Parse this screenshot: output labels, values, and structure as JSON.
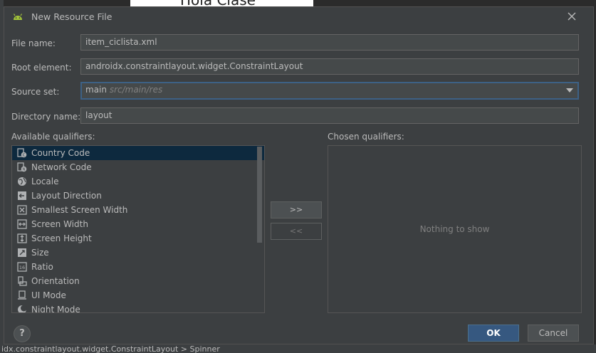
{
  "background": {
    "top_text": "Hola Clase",
    "status_bar_text": "idx.constraintlayout.widget.ConstraintLayout  >  Spinner"
  },
  "dialog": {
    "title": "New Resource File",
    "fields": {
      "file_name": {
        "label": "File name:",
        "value": "item_ciclista.xml"
      },
      "root_element": {
        "label": "Root element:",
        "value": "androidx.constraintlayout.widget.ConstraintLayout"
      },
      "source_set": {
        "label": "Source set:",
        "value": "main",
        "sub_value": "src/main/res"
      },
      "directory_name": {
        "label": "Directory name:",
        "value": "layout"
      }
    },
    "available_qualifiers": {
      "label": "Available qualifiers:",
      "items": [
        {
          "label": "Country Code",
          "icon": "country-code-icon",
          "selected": true
        },
        {
          "label": "Network Code",
          "icon": "network-code-icon"
        },
        {
          "label": "Locale",
          "icon": "globe-icon"
        },
        {
          "label": "Layout Direction",
          "icon": "layout-direction-icon"
        },
        {
          "label": "Smallest Screen Width",
          "icon": "smallest-width-icon"
        },
        {
          "label": "Screen Width",
          "icon": "screen-width-icon"
        },
        {
          "label": "Screen Height",
          "icon": "screen-height-icon"
        },
        {
          "label": "Size",
          "icon": "size-icon"
        },
        {
          "label": "Ratio",
          "icon": "ratio-icon"
        },
        {
          "label": "Orientation",
          "icon": "orientation-icon"
        },
        {
          "label": "UI Mode",
          "icon": "ui-mode-icon"
        },
        {
          "label": "Night Mode",
          "icon": "night-mode-icon"
        }
      ]
    },
    "chosen_qualifiers": {
      "label": "Chosen qualifiers:",
      "empty_text": "Nothing to show"
    },
    "buttons": {
      "add": ">>",
      "remove": "<<",
      "help": "?",
      "ok": "OK",
      "cancel": "Cancel"
    },
    "colors": {
      "dialog_bg": "#3c3f41",
      "selection": "#0d293e",
      "primary_button": "#365880",
      "focus_border": "#3d6185",
      "android_green": "#a4c639"
    }
  }
}
